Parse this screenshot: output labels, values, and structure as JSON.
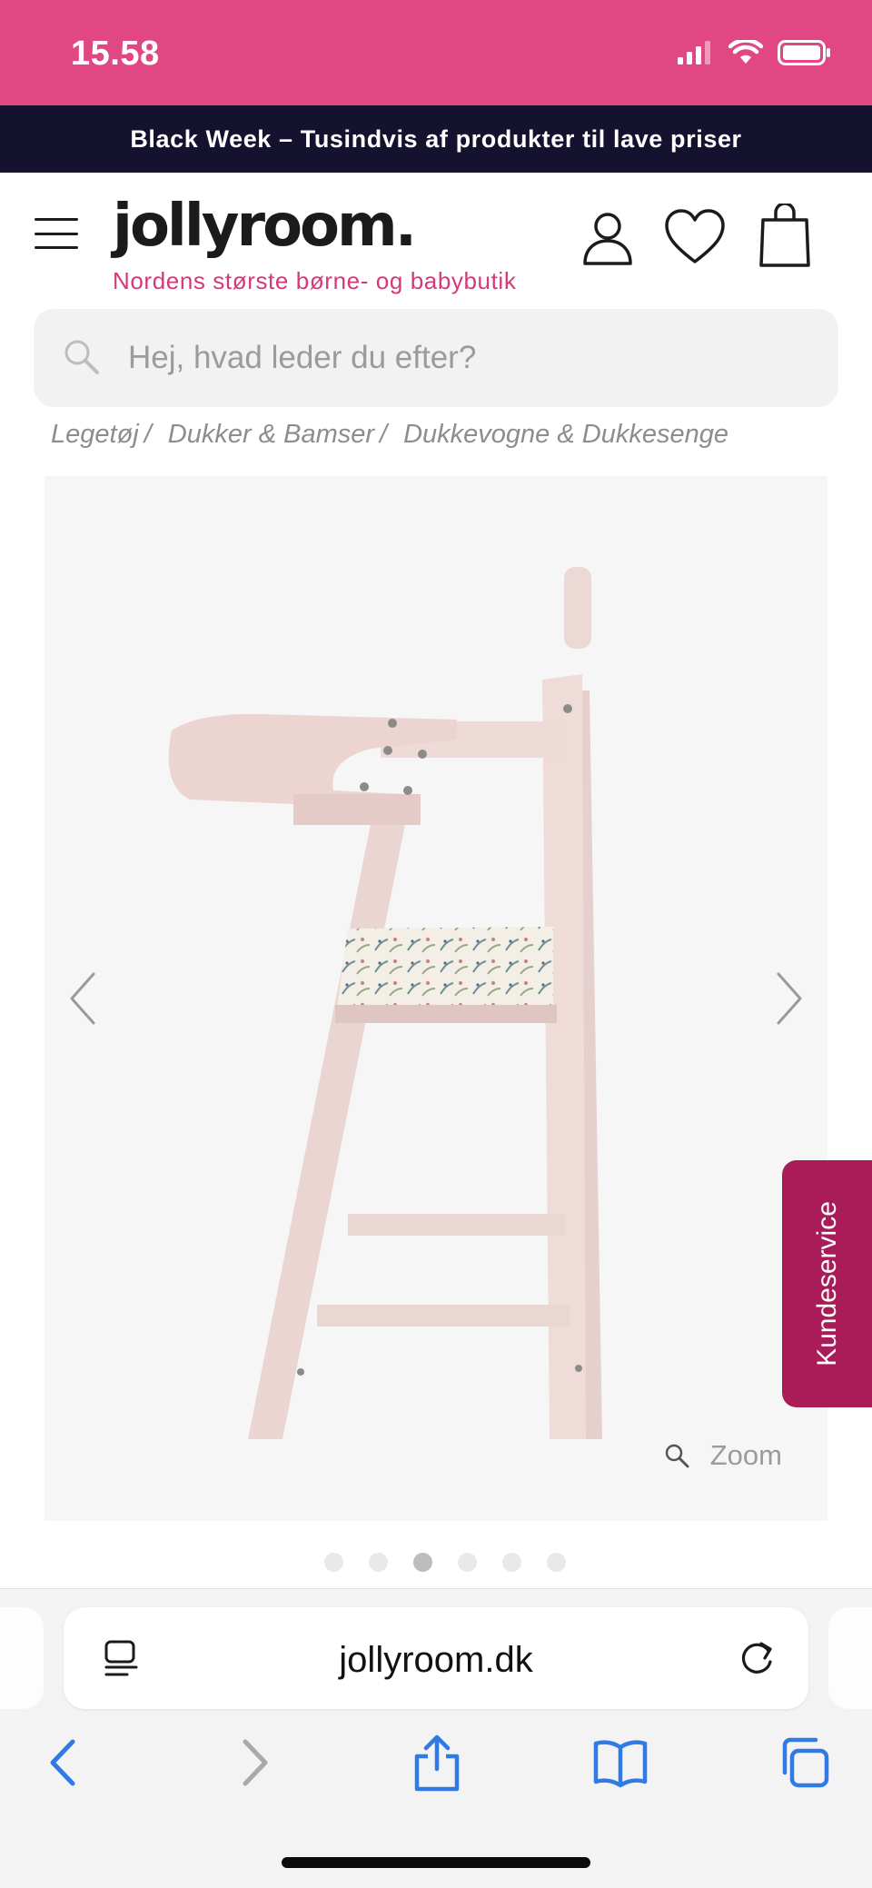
{
  "status_bar": {
    "time": "15.58",
    "background": "#e04783"
  },
  "promo": {
    "text": "Black Week – Tusindvis af produkter til lave priser",
    "background": "#14122e"
  },
  "header": {
    "logo": "jollyroom.",
    "tagline": "Nordens største børne- og babybutik",
    "icons": [
      "menu-icon",
      "account-icon",
      "heart-icon",
      "bag-icon"
    ]
  },
  "search": {
    "placeholder": "Hej, hvad leder du efter?",
    "value": ""
  },
  "breadcrumb": {
    "items": [
      {
        "label": "Legetøj",
        "sep": "/"
      },
      {
        "label": "Dukker & Bamser",
        "sep": "/"
      },
      {
        "label": "Dukkevogne & Dukkesenge",
        "sep": ""
      }
    ]
  },
  "gallery": {
    "zoom_label": "Zoom",
    "image_count": 6,
    "active_index": 2,
    "background": "#f6f6f6"
  },
  "customer_service": {
    "label": "Kundeservice",
    "background": "#a91c58"
  },
  "browser": {
    "url": "jollyroom.dk"
  },
  "colors": {
    "brand_pink": "#d6397a",
    "accent_blue": "#2f7ae5"
  }
}
